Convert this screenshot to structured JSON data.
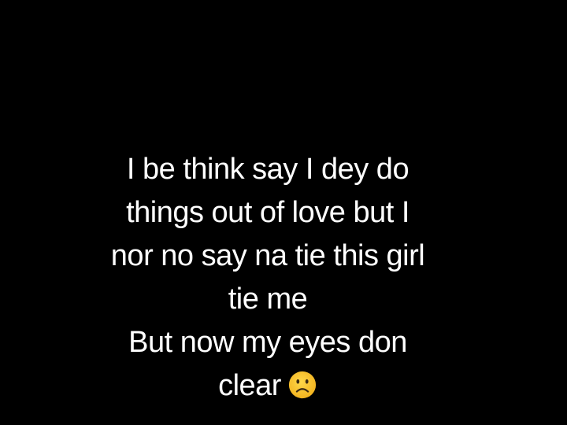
{
  "caption": {
    "lines": [
      "I be think say I dey do",
      "things out of love but I",
      "nor no say na tie this girl",
      "tie me",
      "But now my eyes don",
      "clear"
    ],
    "emoji": "frowning-face-icon"
  },
  "colors": {
    "background": "#000000",
    "text": "#ffffff",
    "emoji_face": "#f7c531",
    "emoji_features": "#3b2a12"
  }
}
